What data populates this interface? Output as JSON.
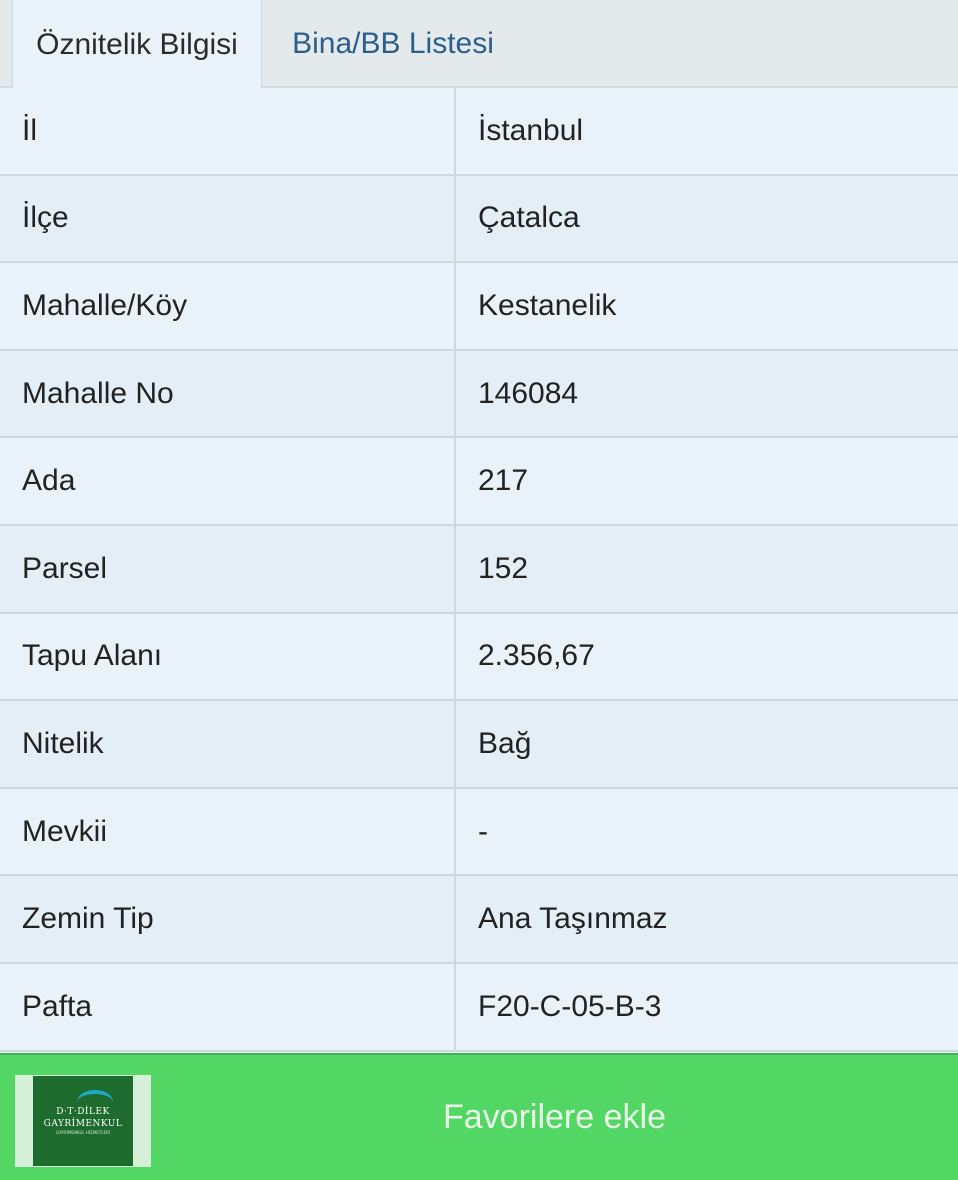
{
  "tabs": [
    {
      "label": "Öznitelik Bilgisi",
      "active": true
    },
    {
      "label": "Bina/BB Listesi",
      "active": false
    }
  ],
  "rows": [
    {
      "key": "İl",
      "value": "İstanbul"
    },
    {
      "key": "İlçe",
      "value": "Çatalca"
    },
    {
      "key": "Mahalle/Köy",
      "value": "Kestanelik"
    },
    {
      "key": "Mahalle No",
      "value": "146084"
    },
    {
      "key": "Ada",
      "value": "217"
    },
    {
      "key": "Parsel",
      "value": "152"
    },
    {
      "key": "Tapu Alanı",
      "value": "2.356,67"
    },
    {
      "key": "Nitelik",
      "value": "Bağ"
    },
    {
      "key": "Mevkii",
      "value": "-"
    },
    {
      "key": "Zemin Tip",
      "value": "Ana Taşınmaz"
    },
    {
      "key": "Pafta",
      "value": "F20-C-05-B-3"
    }
  ],
  "logo": {
    "line1": "D·T·DİLEK",
    "line2": "GAYRİMENKUL",
    "sub": "GAYRİMENKUL HİZMETLERİ"
  },
  "footer": {
    "favorite_label": "Favorilere ekle"
  },
  "colors": {
    "footer_bg": "#52d764",
    "tab_link": "#2a5e8c",
    "table_bg": "#e6f0f7"
  }
}
